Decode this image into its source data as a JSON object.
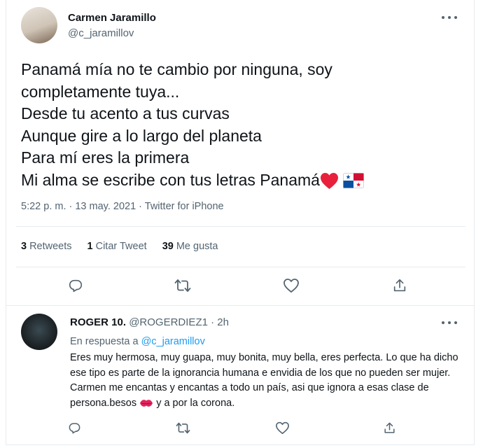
{
  "tweet": {
    "author_name": "Carmen Jaramillo",
    "author_handle": "@c_jaramillov",
    "text_lines": [
      "Panamá mía no te cambio por ninguna, soy",
      "completamente tuya...",
      "Desde tu acento a tus curvas",
      "Aunque gire a lo largo del planeta",
      "Para mí eres la primera",
      "Mi alma se escribe con tus letras Panamá"
    ],
    "meta": "5:22 p. m. · 13 may. 2021 · Twitter for iPhone",
    "stats": {
      "retweets_count": "3",
      "retweets_label": "Retweets",
      "quotes_count": "1",
      "quotes_label": "Citar Tweet",
      "likes_count": "39",
      "likes_label": "Me gusta"
    },
    "icons": [
      "more-icon",
      "reply-icon",
      "retweet-icon",
      "like-icon",
      "share-icon",
      "red-heart-emoji",
      "panama-flag-emoji"
    ]
  },
  "reply": {
    "author_name": "ROGER 10.",
    "author_handle": "@ROGERDIEZ1",
    "time": "· 2h",
    "in_reply_prefix": "En respuesta a",
    "in_reply_handle": "@c_jaramillov",
    "text_before_emoji": "Eres muy hermosa, muy guapa, muy bonita, muy bella, eres perfecta. Lo que ha dicho ese tipo es parte de la ignorancia humana e envidia de los que no pueden ser mujer. Carmen me encantas y encantas a todo un país, asi que ignora a esas clase de persona.besos",
    "text_after_emoji": "y a por la corona.",
    "icons": [
      "more-icon",
      "reply-icon",
      "retweet-icon",
      "like-icon",
      "share-icon",
      "kiss-mark-emoji"
    ]
  },
  "colors": {
    "primary_text": "#0f1419",
    "secondary_text": "#536471",
    "link": "#1d9bf0",
    "divider": "#e6ecf0",
    "heart": "#e8203b"
  }
}
